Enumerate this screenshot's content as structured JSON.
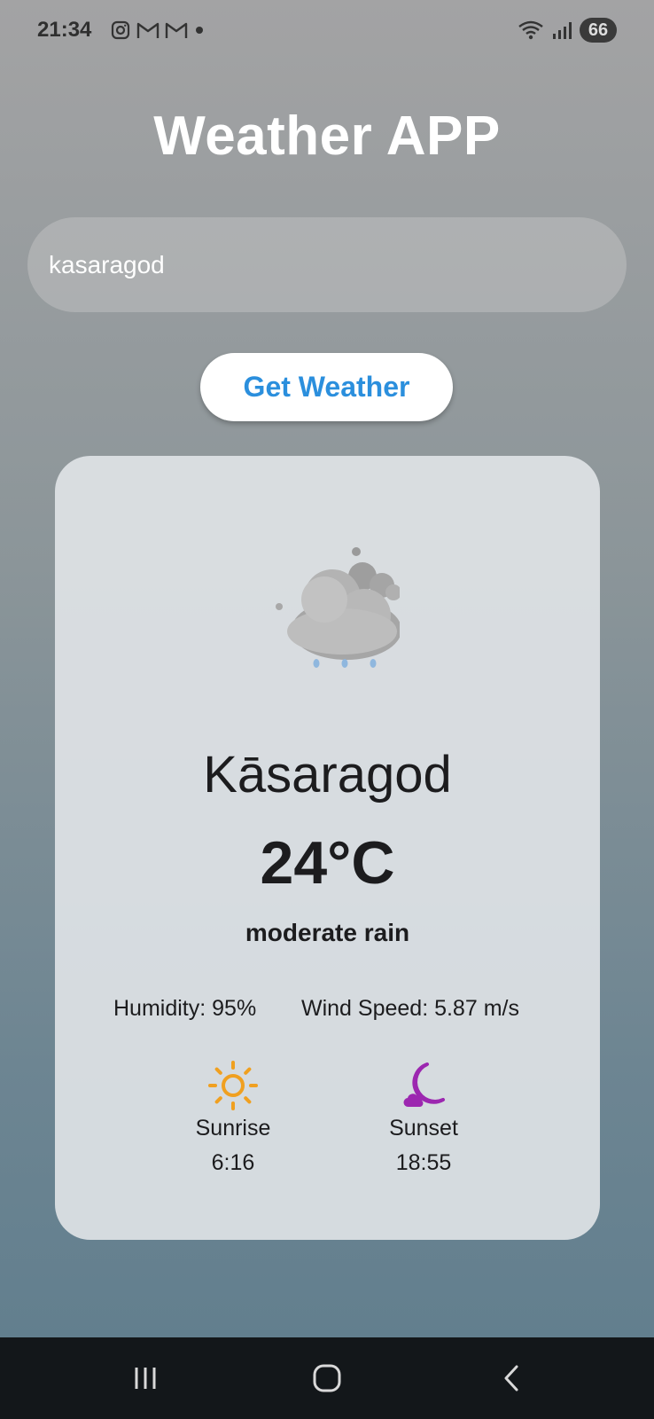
{
  "status_bar": {
    "time": "21:34",
    "battery": "66"
  },
  "app": {
    "title": "Weather APP"
  },
  "search": {
    "value": "kasaragod"
  },
  "button": {
    "label": "Get Weather"
  },
  "weather": {
    "city": "Kāsaragod",
    "temperature": "24°C",
    "description": "moderate rain",
    "humidity": "Humidity: 95%",
    "wind": "Wind Speed: 5.87 m/s",
    "sunrise_label": "Sunrise",
    "sunrise_time": "6:16",
    "sunset_label": "Sunset",
    "sunset_time": "18:55",
    "icon": "cloud-rain-icon"
  },
  "colors": {
    "button_text": "#2b8fdd",
    "sun": "#f0a020",
    "moon": "#9c27b0"
  }
}
